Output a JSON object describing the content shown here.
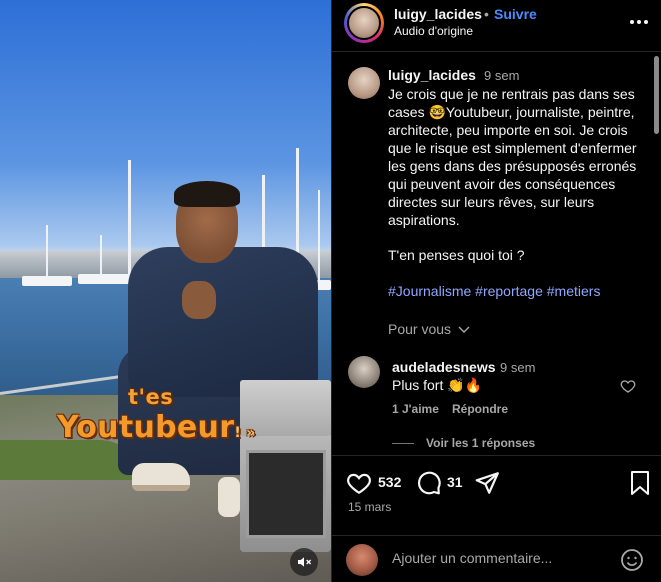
{
  "video": {
    "caption_line1": "t'es",
    "caption_line2": "Youtubeur",
    "caption_tail": "! »",
    "mute_icon": "speaker-muted-icon"
  },
  "header": {
    "username": "luigy_lacides",
    "separator": "•",
    "follow_label": "Suivre",
    "audio_label": "Audio d'origine",
    "more_icon": "more-horizontal-icon"
  },
  "caption": {
    "username": "luigy_lacides",
    "time": "9 sem",
    "text": "Je crois que je ne rentrais pas dans ses cases 🤓Youtubeur, journaliste, peintre, architecte, peu importe en soi. Je crois que le risque est simplement d'enfermer les gens dans des présupposés erronés qui peuvent avoir des conséquences directes sur leurs rêves, sur leurs aspirations.",
    "question": "T'en penses quoi toi ?",
    "hashtags": "#Journalisme #reportage #metiers",
    "pour_vous": "Pour vous"
  },
  "comment": {
    "username": "audeladesnews",
    "time": "9 sem",
    "text": "Plus fort 👏🔥",
    "likes_label": "1 J'aime",
    "reply_label": "Répondre",
    "view_replies": "Voir les 1 réponses"
  },
  "actions": {
    "likes": "532",
    "comments": "31",
    "date": "15 mars"
  },
  "add_comment": {
    "placeholder": "Ajouter un commentaire..."
  },
  "colors": {
    "link": "#4a8cff",
    "hashtag": "#8fa7ff",
    "muted_text": "#a8a8a8",
    "background": "#000000"
  }
}
